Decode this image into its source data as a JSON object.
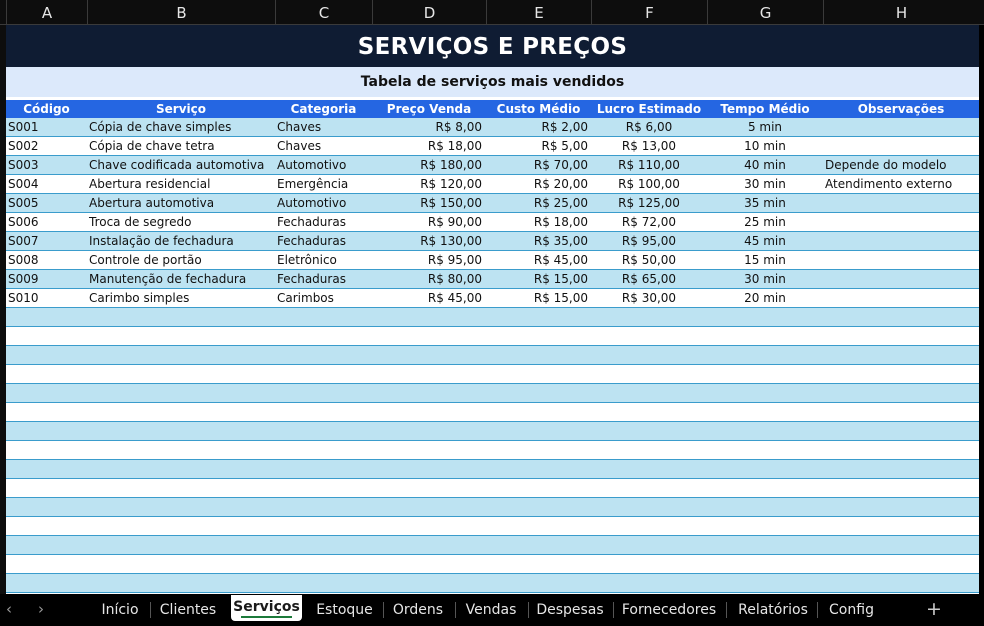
{
  "columns": [
    "A",
    "B",
    "C",
    "D",
    "E",
    "F",
    "G",
    "H"
  ],
  "title": "SERVIÇOS E PREÇOS",
  "subtitle": "Tabela de serviços mais vendidos",
  "headers": [
    "Código",
    "Serviço",
    "Categoria",
    "Preço Venda",
    "Custo Médio",
    "Lucro Estimado",
    "Tempo Médio",
    "Observações"
  ],
  "rows": [
    [
      "S001",
      "Cópia de chave simples",
      "Chaves",
      "R$ 8,00",
      "R$ 2,00",
      "R$ 6,00",
      "5 min",
      ""
    ],
    [
      "S002",
      "Cópia de chave tetra",
      "Chaves",
      "R$ 18,00",
      "R$ 5,00",
      "R$ 13,00",
      "10 min",
      ""
    ],
    [
      "S003",
      "Chave codificada automotiva",
      "Automotivo",
      "R$ 180,00",
      "R$ 70,00",
      "R$ 110,00",
      "40 min",
      "Depende do modelo"
    ],
    [
      "S004",
      "Abertura residencial",
      "Emergência",
      "R$ 120,00",
      "R$ 20,00",
      "R$ 100,00",
      "30 min",
      "Atendimento externo"
    ],
    [
      "S005",
      "Abertura automotiva",
      "Automotivo",
      "R$ 150,00",
      "R$ 25,00",
      "R$ 125,00",
      "35 min",
      ""
    ],
    [
      "S006",
      "Troca de segredo",
      "Fechaduras",
      "R$ 90,00",
      "R$ 18,00",
      "R$ 72,00",
      "25 min",
      ""
    ],
    [
      "S007",
      "Instalação de fechadura",
      "Fechaduras",
      "R$ 130,00",
      "R$ 35,00",
      "R$ 95,00",
      "45 min",
      ""
    ],
    [
      "S008",
      "Controle de portão",
      "Eletrônico",
      "R$ 95,00",
      "R$ 45,00",
      "R$ 50,00",
      "15 min",
      ""
    ],
    [
      "S009",
      "Manutenção de fechadura",
      "Fechaduras",
      "R$ 80,00",
      "R$ 15,00",
      "R$ 65,00",
      "30 min",
      ""
    ],
    [
      "S010",
      "Carimbo simples",
      "Carimbos",
      "R$ 45,00",
      "R$ 15,00",
      "R$ 30,00",
      "20 min",
      ""
    ]
  ],
  "tabs": [
    "Início",
    "Clientes",
    "Serviços",
    "Estoque",
    "Ordens",
    "Vendas",
    "Despesas",
    "Fornecedores",
    "Relatórios",
    "Config"
  ],
  "active_tab": "Serviços",
  "nav": {
    "prev": "‹",
    "next": "›",
    "add": "+"
  },
  "colors": {
    "title_bg": "#0f1c33",
    "subtitle_bg": "#dce9fb",
    "header_bg": "#2566e2",
    "band": "#bde3f2",
    "row_border": "#3a9ccc",
    "active_tab_underline": "#1c7a3a"
  }
}
